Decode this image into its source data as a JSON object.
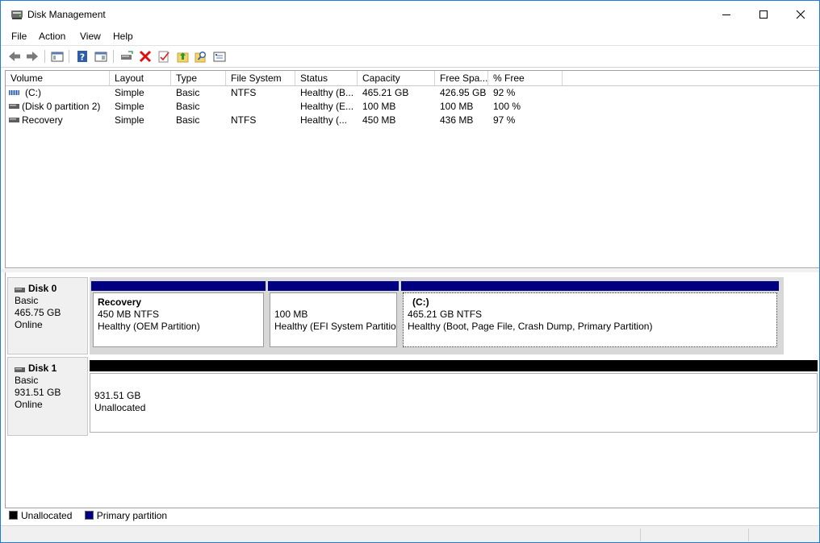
{
  "window": {
    "title": "Disk Management"
  },
  "menu": [
    "File",
    "Action",
    "View",
    "Help"
  ],
  "toolbar_icons": [
    "back-arrow-icon",
    "forward-arrow-icon",
    "console-tree-icon",
    "help-icon",
    "properties-icon",
    "connect-disk-icon",
    "delete-icon",
    "checklist-icon",
    "up-folder-icon",
    "search-icon",
    "properties-pane-icon"
  ],
  "colors": {
    "primary_partition": "#000080",
    "unallocated": "#000000",
    "window_border": "#1d7be0"
  },
  "columns": [
    "Volume",
    "Layout",
    "Type",
    "File System",
    "Status",
    "Capacity",
    "Free Spa...",
    "% Free"
  ],
  "volumes": [
    {
      "icon": "volume-striped-icon",
      "volume": "(C:)",
      "layout": "Simple",
      "type": "Basic",
      "fs": "NTFS",
      "status": "Healthy (B...",
      "capacity": "465.21 GB",
      "free": "426.95 GB",
      "pct": "92 %"
    },
    {
      "icon": "volume-icon",
      "volume": "(Disk 0 partition 2)",
      "layout": "Simple",
      "type": "Basic",
      "fs": "",
      "status": "Healthy (E...",
      "capacity": "100 MB",
      "free": "100 MB",
      "pct": "100 %"
    },
    {
      "icon": "volume-icon",
      "volume": "Recovery",
      "layout": "Simple",
      "type": "Basic",
      "fs": "NTFS",
      "status": "Healthy (...",
      "capacity": "450 MB",
      "free": "436 MB",
      "pct": "97 %"
    }
  ],
  "disks": [
    {
      "name": "Disk 0",
      "kind": "Basic",
      "size": "465.75 GB",
      "state": "Online",
      "partitions": [
        {
          "label": "Recovery",
          "size": "450 MB NTFS",
          "status": "Healthy (OEM Partition)"
        },
        {
          "label": "",
          "size": "100 MB",
          "status": "Healthy (EFI System Partition)"
        },
        {
          "label": "(C:)",
          "size": "465.21 GB NTFS",
          "status": "Healthy (Boot, Page File, Crash Dump, Primary Partition)"
        }
      ]
    },
    {
      "name": "Disk 1",
      "kind": "Basic",
      "size": "931.51 GB",
      "state": "Online",
      "partitions": [
        {
          "label": "",
          "size": "931.51 GB",
          "status": "Unallocated"
        }
      ]
    }
  ],
  "legend": [
    "Unallocated",
    "Primary partition"
  ]
}
